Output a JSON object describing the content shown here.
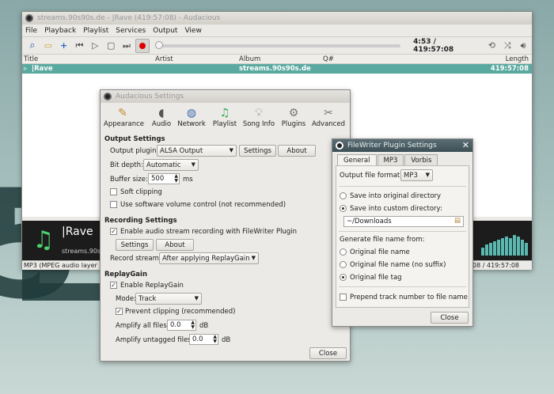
{
  "main": {
    "title": "streams.90s90s.de - |Rave (419:57:08) - Audacious",
    "menu": [
      "File",
      "Playback",
      "Playlist",
      "Services",
      "Output",
      "View"
    ],
    "time": "4:53 / 419:57:08",
    "columns": {
      "title": "Title",
      "artist": "Artist",
      "album": "Album",
      "num": "Q#",
      "length": "Length"
    },
    "row": {
      "title": "|Rave",
      "album": "streams.90s90s.de",
      "length": "419:57:08"
    },
    "info": {
      "title": "|Rave",
      "subtitle": "streams.90s9"
    },
    "status_left": "MP3 (MPEG audio layer 3",
    "status_right": "08 / 419:57:08"
  },
  "settings": {
    "title": "Audacious Settings",
    "tabs": [
      {
        "label": "Appearance",
        "icon": "appearance-icon"
      },
      {
        "label": "Audio",
        "icon": "audio-icon"
      },
      {
        "label": "Network",
        "icon": "network-icon"
      },
      {
        "label": "Playlist",
        "icon": "playlist-icon"
      },
      {
        "label": "Song Info",
        "icon": "song-info-icon"
      },
      {
        "label": "Plugins",
        "icon": "plugins-icon"
      },
      {
        "label": "Advanced",
        "icon": "advanced-icon"
      }
    ],
    "output_settings": "Output Settings",
    "output_plugin_label": "Output plugin:",
    "output_plugin_value": "ALSA Output",
    "settings_btn": "Settings",
    "about_btn": "About",
    "bit_depth_label": "Bit depth:",
    "bit_depth_value": "Automatic",
    "buffer_label": "Buffer size:",
    "buffer_value": "500",
    "buffer_unit": "ms",
    "soft_clipping": "Soft clipping",
    "sw_volume": "Use software volume control (not recommended)",
    "recording_settings": "Recording Settings",
    "enable_recording": "Enable audio stream recording with FileWriter Plugin",
    "rec_settings_btn": "Settings",
    "rec_about_btn": "About",
    "record_stream_label": "Record stream:",
    "record_stream_value": "After applying ReplayGain",
    "replaygain": "ReplayGain",
    "enable_replaygain": "Enable ReplayGain",
    "mode_label": "Mode:",
    "mode_value": "Track",
    "prevent_clipping": "Prevent clipping (recommended)",
    "amplify_all_label": "Amplify all files:",
    "amplify_all_value": "0.0",
    "amplify_untagged_label": "Amplify untagged files:",
    "amplify_untagged_value": "0.0",
    "db": "dB",
    "close_btn": "Close"
  },
  "filewriter": {
    "title": "FileWriter Plugin Settings",
    "tabs": [
      "General",
      "MP3",
      "Vorbis"
    ],
    "format_label": "Output file format:",
    "format_value": "MP3",
    "save_original": "Save into original directory",
    "save_custom": "Save into custom directory:",
    "directory": "~/Downloads",
    "generate_label": "Generate file name from:",
    "opt_name": "Original file name",
    "opt_name_nosuffix": "Original file name (no suffix)",
    "opt_tag": "Original file tag",
    "prepend": "Prepend track number to file name",
    "close_btn": "Close"
  },
  "colors": {
    "accent": "#5aa9a1",
    "record": "#dd0000",
    "titlebar": "#3e4f56"
  }
}
